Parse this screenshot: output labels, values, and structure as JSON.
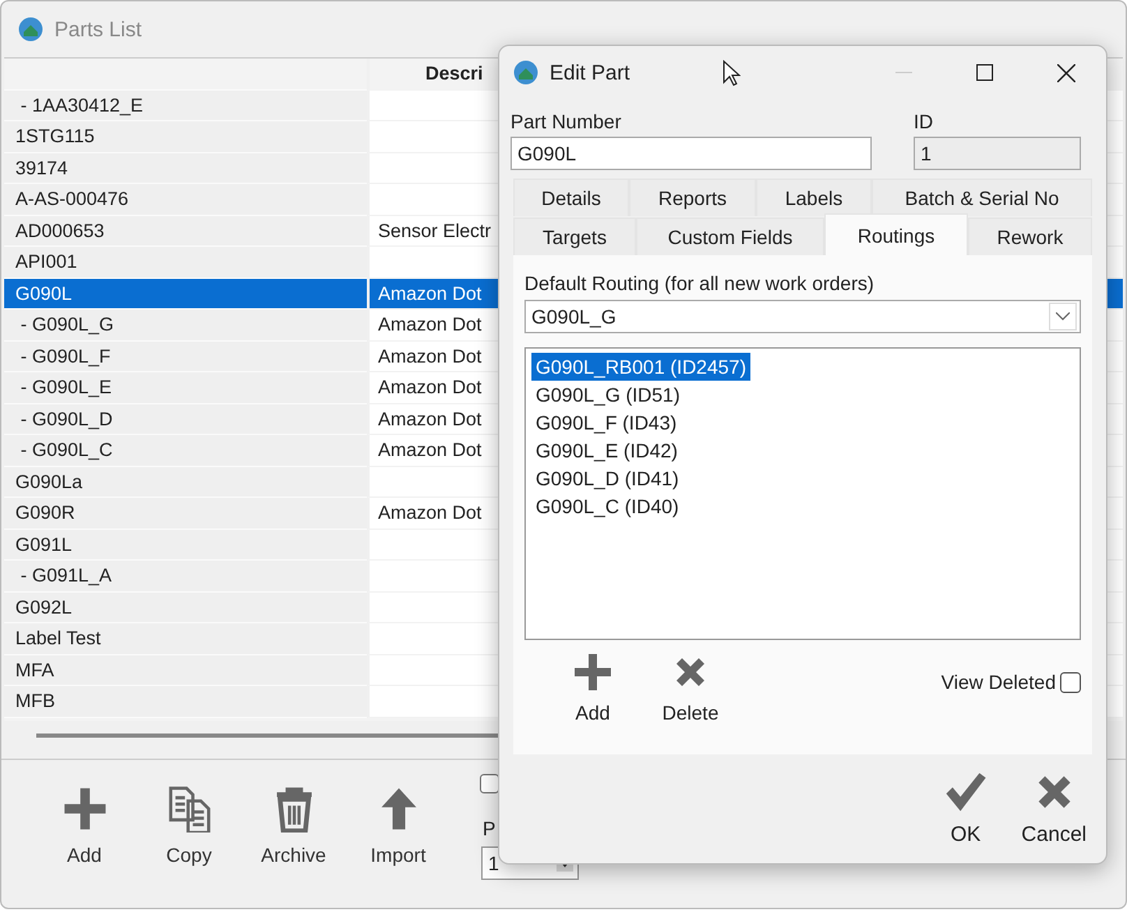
{
  "parts_list": {
    "title": "Parts List",
    "table": {
      "columns": [
        {},
        {
          "label": "Descri"
        }
      ],
      "rows": [
        {
          "part": " - 1AA30412_E",
          "description": "",
          "selected": false
        },
        {
          "part": "1STG115",
          "description": "",
          "selected": false
        },
        {
          "part": "39174",
          "description": "",
          "selected": false
        },
        {
          "part": "A-AS-000476",
          "description": "",
          "selected": false
        },
        {
          "part": "AD000653",
          "description": "Sensor Electr",
          "selected": false
        },
        {
          "part": "API001",
          "description": "",
          "selected": false
        },
        {
          "part": "G090L",
          "description": "Amazon Dot",
          "selected": true
        },
        {
          "part": " - G090L_G",
          "description": "Amazon Dot",
          "selected": false
        },
        {
          "part": " - G090L_F",
          "description": "Amazon Dot",
          "selected": false
        },
        {
          "part": " - G090L_E",
          "description": "Amazon Dot",
          "selected": false
        },
        {
          "part": " - G090L_D",
          "description": "Amazon Dot",
          "selected": false
        },
        {
          "part": " - G090L_C",
          "description": "Amazon Dot",
          "selected": false
        },
        {
          "part": "G090La",
          "description": "",
          "selected": false
        },
        {
          "part": "G090R",
          "description": "Amazon Dot",
          "selected": false
        },
        {
          "part": "G091L",
          "description": "",
          "selected": false
        },
        {
          "part": " - G091L_A",
          "description": "",
          "selected": false
        },
        {
          "part": "G092L",
          "description": "",
          "selected": false
        },
        {
          "part": "Label Test",
          "description": "",
          "selected": false
        },
        {
          "part": "MFA",
          "description": "",
          "selected": false
        },
        {
          "part": "MFB",
          "description": "",
          "selected": false
        }
      ]
    },
    "toolbar": [
      {
        "label": "Add",
        "kind": "plus"
      },
      {
        "label": "Copy",
        "kind": "copy"
      },
      {
        "label": "Archive",
        "kind": "trash"
      },
      {
        "label": "Import",
        "kind": "up"
      }
    ],
    "option_checkbox": {
      "checked": false
    },
    "page_label": "P",
    "page_select": {
      "value": "1"
    }
  },
  "edit_part": {
    "title": "Edit Part",
    "part_number": {
      "label": "Part Number",
      "value": "G090L"
    },
    "id": {
      "label": "ID",
      "value": "1"
    },
    "tab_rows": [
      [
        {
          "label": "Details",
          "selected": false
        },
        {
          "label": "Reports",
          "selected": false
        },
        {
          "label": "Labels",
          "selected": false
        },
        {
          "label": "Batch & Serial No",
          "selected": false
        }
      ],
      [
        {
          "label": "Targets",
          "selected": false
        },
        {
          "label": "Custom Fields",
          "selected": false
        },
        {
          "label": "Routings",
          "selected": true
        },
        {
          "label": "Rework",
          "selected": false
        }
      ]
    ],
    "default_routing": {
      "label": "Default Routing (for all new work orders)",
      "value": "G090L_G"
    },
    "routings": [
      {
        "label": "G090L_RB001 (ID2457)",
        "selected": true
      },
      {
        "label": "G090L_G (ID51)",
        "selected": false
      },
      {
        "label": "G090L_F (ID43)",
        "selected": false
      },
      {
        "label": "G090L_E (ID42)",
        "selected": false
      },
      {
        "label": "G090L_D (ID41)",
        "selected": false
      },
      {
        "label": "G090L_C (ID40)",
        "selected": false
      }
    ],
    "routing_actions": [
      {
        "label": "Add",
        "kind": "plus"
      },
      {
        "label": "Delete",
        "kind": "cross"
      }
    ],
    "view_deleted": {
      "label": "View Deleted",
      "checked": false
    },
    "footer_buttons": [
      {
        "label": "OK",
        "kind": "check"
      },
      {
        "label": "Cancel",
        "kind": "cross"
      }
    ]
  }
}
